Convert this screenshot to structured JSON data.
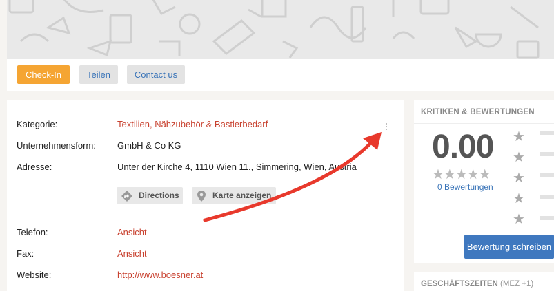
{
  "actions": {
    "checkin": "Check-In",
    "share": "Teilen",
    "contact": "Contact us"
  },
  "details": {
    "rows": [
      {
        "label": "Kategorie:",
        "value": "Textilien, Nähzubehör & Bastlerbedarf"
      },
      {
        "label": "Unternehmensform:",
        "value": "GmbH & Co KG"
      },
      {
        "label": "Adresse:",
        "value": "Unter der Kirche 4, 1110 Wien 11., Simmering, Wien, Austria"
      },
      {
        "label": "Telefon:",
        "value": "Ansicht"
      },
      {
        "label": "Fax:",
        "value": "Ansicht"
      },
      {
        "label": "Website:",
        "value": "http://www.boesner.at"
      }
    ],
    "directions_label": "Directions",
    "map_label": "Karte anzeigen"
  },
  "reviews": {
    "title": "KRITIKEN & BEWERTUNGEN",
    "score": "0.00",
    "stars": "★★★★★",
    "count_text": "0 Bewertungen",
    "write_button": "Bewertung schreiben",
    "star_glyph": "★",
    "rating": 0
  },
  "hours": {
    "title": "GESCHÄFTSZEITEN",
    "timezone": "(MEZ +1)"
  },
  "colors": {
    "accent_orange": "#f5a533",
    "link_red": "#c8412f",
    "link_blue": "#3a74b8",
    "arrow": "#e8392c"
  }
}
